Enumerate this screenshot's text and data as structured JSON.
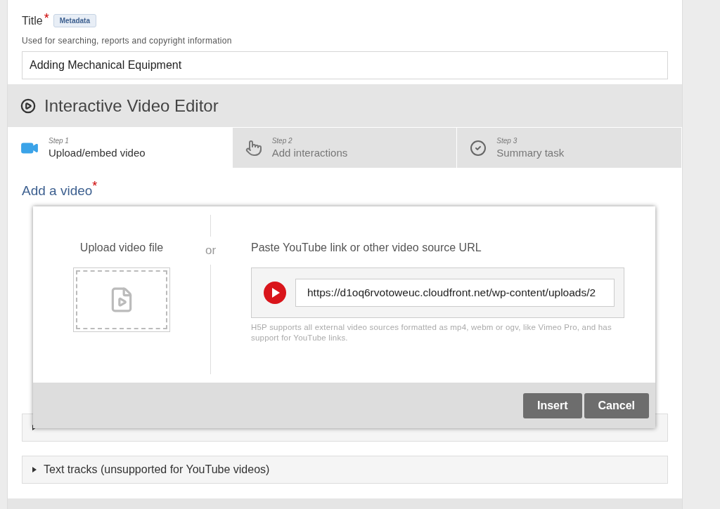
{
  "title_field": {
    "label": "Title",
    "required_mark": "*",
    "badge": "Metadata",
    "description": "Used for searching, reports and copyright information",
    "value": "Adding Mechanical Equipment"
  },
  "editor": {
    "heading": "Interactive Video Editor",
    "steps": [
      {
        "step": "Step 1",
        "label": "Upload/embed video",
        "selected": true,
        "kind": "video"
      },
      {
        "step": "Step 2",
        "label": "Add interactions",
        "selected": false,
        "kind": "interactions"
      },
      {
        "step": "Step 3",
        "label": "Summary task",
        "selected": false,
        "kind": "summary"
      }
    ],
    "section": {
      "heading": "Add a video",
      "required_mark": "*"
    },
    "accordions": [
      {
        "expanded": false
      },
      {
        "label": "Text tracks (unsupported for YouTube videos)",
        "expanded": false
      }
    ]
  },
  "dialog": {
    "upload_label": "Upload video file",
    "separator": "or",
    "url_label": "Paste YouTube link or other video source URL",
    "url_value": "https://d1oq6rvotoweuc.cloudfront.net/wp-content/uploads/2",
    "hint": "H5P supports all external video sources formatted as mp4, webm or ogv, like Vimeo Pro, and has support for YouTube links.",
    "buttons": [
      "Insert",
      "Cancel"
    ]
  }
}
